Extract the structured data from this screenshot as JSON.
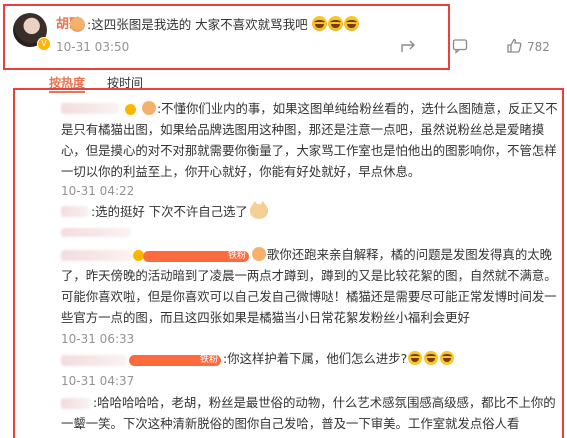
{
  "post": {
    "author": "胡歌",
    "text": ":这四张图是我选的 大家不喜欢就骂我吧",
    "time": "10-31 03:50",
    "likes": "782",
    "emoji_count": 3
  },
  "sort_tabs": [
    {
      "label": "按热度",
      "active": true
    },
    {
      "label": "按时间",
      "active": false
    }
  ],
  "comments": [
    {
      "text": ":不懂你们业内的事，如果这图单纯给粉丝看的，选什么图随意，反正又不是只有橘猫出图，如果给品牌选图用这种图，那还是注意一点吧，虽然说粉丝总是爱睹摸心，但是摸心的对不对那就需要你衡量了，大家骂工作室也是怕他出的图影响你，不管怎样一切以你的利益至上，你开心就好，你能有好处就好，早点休息。",
      "time": "10-31 04:22"
    },
    {
      "text": ":选的挺好 下次不许自己选了",
      "time": ""
    },
    {
      "badge": "铁粉",
      "text": "歌你还跑来亲自解释，橘的问题是发图发得真的太晚了，昨天傍晚的活动暗到了凌晨一两点才蹲到，蹲到的又是比较花絮的图，自然就不满意。可能你喜欢啦，但是你喜欢可以自己发自己微博哒！橘猫还是需要尽可能正常发博时间发一些官方一点的图，而且这四张如果是橘猫当小日常花絮发粉丝小福利会更好",
      "time": "10-31 06:33"
    },
    {
      "badge": "铁粉",
      "text": ":你这样护着下属，他们怎么进步?",
      "time": "10-31 04:37"
    },
    {
      "text": ":哈哈哈哈哈，老胡，粉丝是最世俗的动物，什么艺术感氛围感高级感，都比不上你的一颦一笑。下次这种清新脱俗的图你自己发哈，普及一下审美。工作室就发点俗人看",
      "time": ""
    }
  ],
  "colors": {
    "accent": "#eb7350",
    "highlight_border": "#e8413c",
    "muted": "#939393"
  },
  "icons": [
    "share-icon",
    "comment-icon",
    "like-icon",
    "laugh-emoji-icon",
    "cat-emoji-icon",
    "shy-emoji-icon",
    "verified-badge-icon"
  ]
}
